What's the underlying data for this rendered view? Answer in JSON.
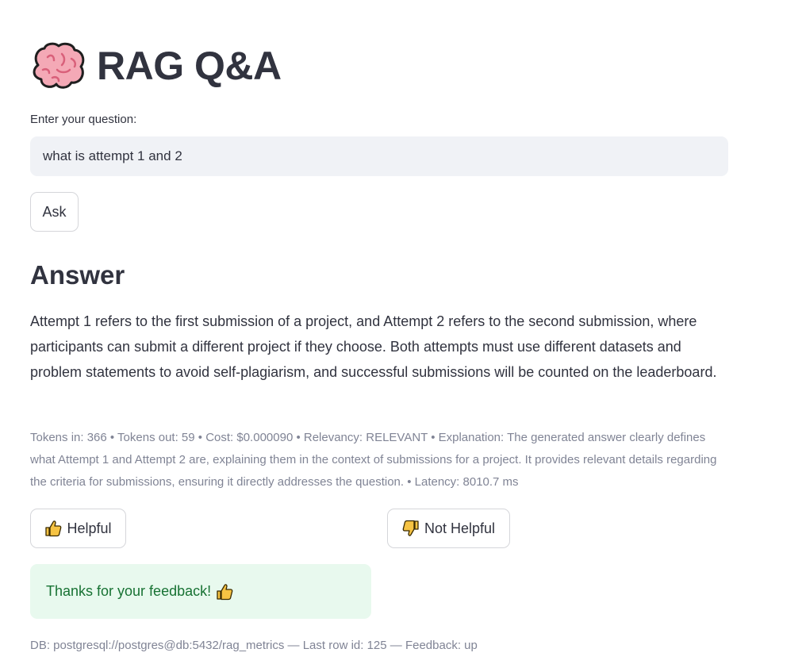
{
  "header": {
    "icon": "brain-icon",
    "title": "RAG Q&A"
  },
  "question": {
    "label": "Enter your question:",
    "value": "what is attempt 1 and 2"
  },
  "ask_button": {
    "label": "Ask"
  },
  "answer": {
    "heading": "Answer",
    "text": "Attempt 1 refers to the first submission of a project, and Attempt 2 refers to the second submission, where participants can submit a different project if they choose. Both attempts must use different datasets and problem statements to avoid self-plagiarism, and successful submissions will be counted on the leaderboard.",
    "meta": "Tokens in: 366 • Tokens out: 59 • Cost: $0.000090 • Relevancy: RELEVANT • Explanation: The generated answer clearly defines what Attempt 1 and Attempt 2 are, explaining them in the context of submissions for a project. It provides relevant details regarding the criteria for submissions, ensuring it directly addresses the question. • Latency: 8010.7 ms"
  },
  "feedback": {
    "helpful_label": "Helpful",
    "helpful_icon": "thumbs-up-icon",
    "not_helpful_label": "Not Helpful",
    "not_helpful_icon": "thumbs-down-icon",
    "success_message": "Thanks for your feedback!",
    "success_icon": "thumbs-up-icon"
  },
  "footer": {
    "db_caption": "DB: postgresql://postgres@db:5432/rag_metrics — Last row id: 125 — Feedback: up"
  },
  "colors": {
    "text": "#31333f",
    "muted": "#808495",
    "input_bg": "#f0f2f6",
    "success_bg": "#e8f9ee",
    "success_text": "#177233",
    "emoji_yellow": "#f6c343",
    "brain_pink": "#f4a9b6"
  }
}
